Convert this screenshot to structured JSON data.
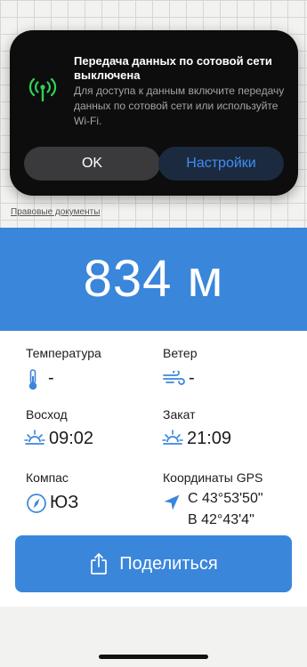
{
  "map": {
    "legal_link": "Правовые документы"
  },
  "alert": {
    "icon": "cellular-antenna-icon",
    "title": "Передача данных по сотовой сети выключена",
    "message": "Для доступа к данным включите передачу данных по сотовой сети или используйте Wi‑Fi.",
    "ok_label": "OK",
    "settings_label": "Настройки"
  },
  "altitude": {
    "value": "834 м"
  },
  "info": {
    "temperature": {
      "label": "Температура",
      "value": "-",
      "icon": "thermometer-icon"
    },
    "wind": {
      "label": "Ветер",
      "value": "-",
      "icon": "wind-icon"
    },
    "sunrise": {
      "label": "Восход",
      "value": "09:02",
      "icon": "sunrise-icon"
    },
    "sunset": {
      "label": "Закат",
      "value": "21:09",
      "icon": "sunset-icon"
    },
    "compass": {
      "label": "Компас",
      "value": "ЮЗ",
      "icon": "compass-icon"
    },
    "gps": {
      "label": "Координаты GPS",
      "lat": "С 43°53'50\"",
      "lon": "В 42°43'4\"",
      "icon": "location-arrow-icon"
    }
  },
  "share": {
    "label": "Поделиться",
    "icon": "share-icon"
  },
  "colors": {
    "accent": "#3a86db",
    "icon_blue": "#3a86db",
    "alert_bg": "#0d0d0d",
    "alert_link": "#3f8ef7",
    "antenna_green": "#30d158"
  }
}
